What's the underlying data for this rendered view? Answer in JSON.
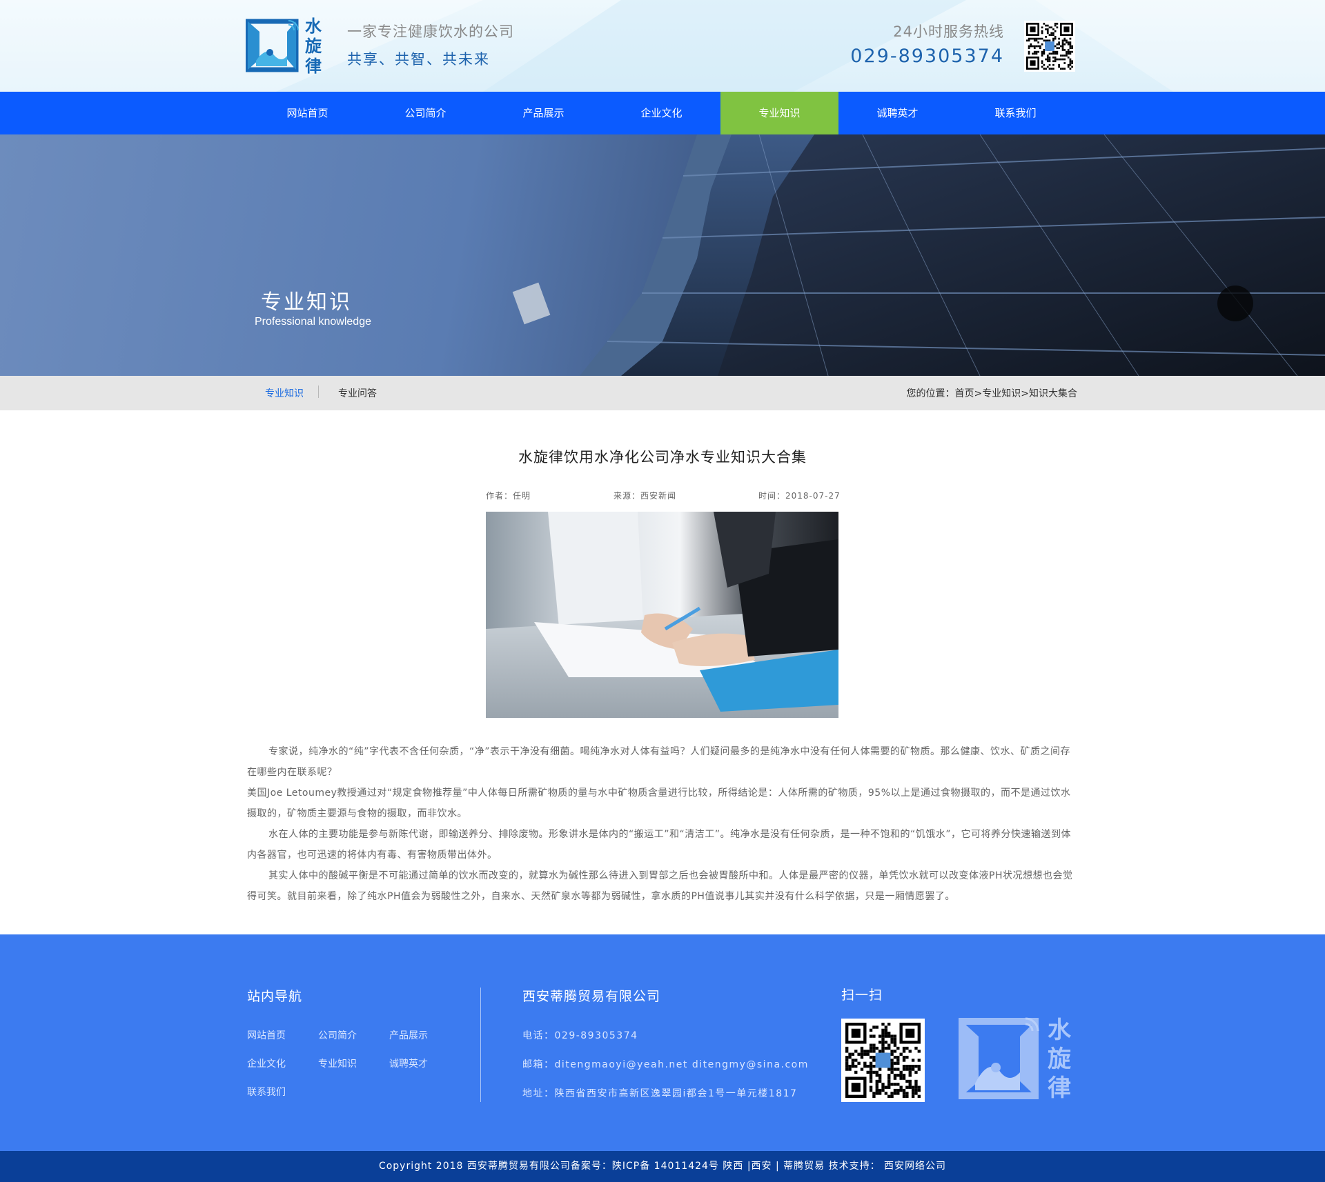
{
  "header": {
    "logo_chars": [
      "水",
      "旋",
      "律"
    ],
    "slogan_line1": "一家专注健康饮水的公司",
    "slogan_line2": "共享、共智、共未来",
    "hotline_label": "24小时服务热线",
    "hotline_number": "029-89305374"
  },
  "nav": {
    "items": [
      "网站首页",
      "公司简介",
      "产品展示",
      "企业文化",
      "专业知识",
      "诚聘英才",
      "联系我们"
    ],
    "active_index": 4
  },
  "banner": {
    "title": "专业知识",
    "subtitle": "Professional knowledge"
  },
  "subnav": {
    "tab_active": "专业知识",
    "tab_other": "专业问答",
    "location": "您的位置：首页>专业知识>知识大集合"
  },
  "article": {
    "title": "水旋律饮用水净化公司净水专业知识大合集",
    "author": "作者：任明",
    "source": "来源：西安新闻",
    "time": "时间：2018-07-27",
    "paragraphs": [
      "专家说，纯净水的“纯”字代表不含任何杂质，“净”表示干净没有细菌。喝纯净水对人体有益吗？人们疑问最多的是纯净水中没有任何人体需要的矿物质。那么健康、饮水、矿质之间存在哪些内在联系呢？",
      "美国Joe Letoumey教授通过对“规定食物推荐量”中人体每日所需矿物质的量与水中矿物质含量进行比较，所得结论是：人体所需的矿物质，95%以上是通过食物摄取的，而不是通过饮水摄取的，矿物质主要源与食物的摄取，而非饮水。",
      "水在人体的主要功能是参与新陈代谢，即输送养分、排除废物。形象讲水是体内的“搬运工”和“清洁工”。纯净水是没有任何杂质，是一种不饱和的“饥饿水”，它可将养分快速输送到体内各器官，也可迅速的将体内有毒、有害物质带出体外。",
      "其实人体中的酸碱平衡是不可能通过简单的饮水而改变的，就算水为碱性那么待进入到胃部之后也会被胃酸所中和。人体是最严密的仪器，单凭饮水就可以改变体液PH状况想想也会觉得可笑。就目前来看，除了纯水PH值会为弱酸性之外，自来水、天然矿泉水等都为弱碱性，拿水质的PH值说事儿其实并没有什么科学依据，只是一厢情愿罢了。"
    ]
  },
  "footer": {
    "nav_title": "站内导航",
    "nav_links": [
      "网站首页",
      "公司简介",
      "产品展示",
      "企业文化",
      "专业知识",
      "诚聘英才",
      "联系我们"
    ],
    "company_name": "西安蒂腾贸易有限公司",
    "phone": "电话：029-89305374",
    "email": "邮箱：ditengmaoyi@yeah.net  ditengmy@sina.com",
    "address": "地址：陕西省西安市高新区逸翠园i都会1号一单元楼1817",
    "scan_title": "扫一扫",
    "logo_chars": [
      "水",
      "旋",
      "律"
    ],
    "copyright": "Copyright  2018 西安蒂腾贸易有限公司备案号：陕ICP备 14011424号    陕西 |西安 |   蒂腾贸易    技术支持：  西安网络公司"
  },
  "colors": {
    "nav_bg": "#0b5bff",
    "nav_active": "#80c341",
    "footer_bg": "#3c7bf0",
    "copyright_bg": "#0a3f98",
    "accent_blue": "#1e63ad"
  }
}
